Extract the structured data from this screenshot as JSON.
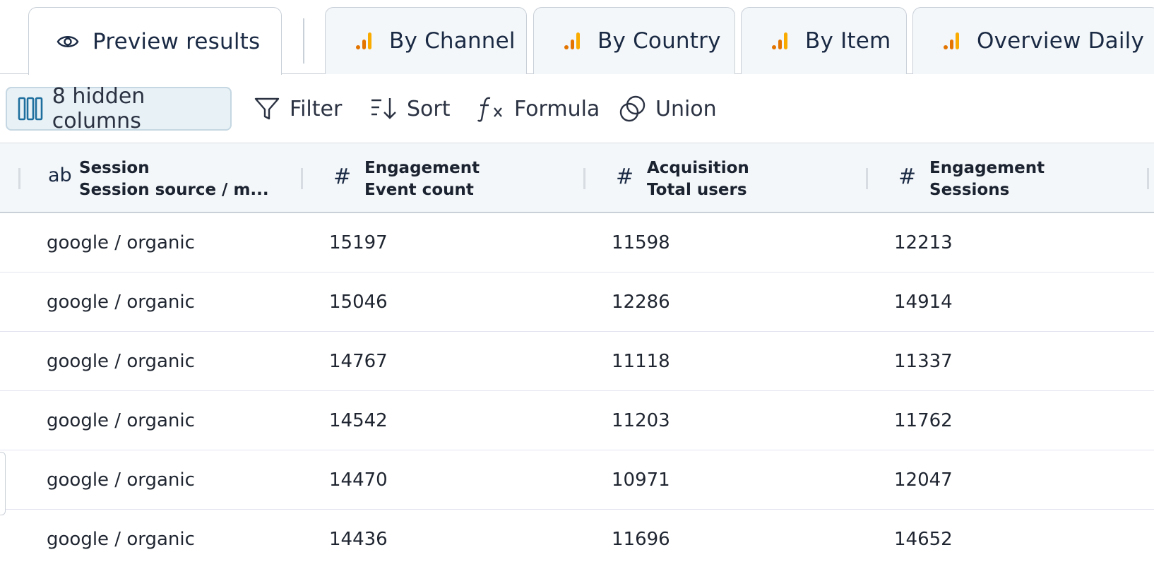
{
  "tabs": [
    {
      "label": "Preview results",
      "icon": "eye-icon",
      "active": true
    },
    {
      "label": "By Channel",
      "icon": "bar-chart-icon",
      "active": false
    },
    {
      "label": "By Country",
      "icon": "bar-chart-icon",
      "active": false
    },
    {
      "label": "By Item",
      "icon": "bar-chart-icon",
      "active": false
    },
    {
      "label": "Overview Daily",
      "icon": "bar-chart-icon",
      "active": false
    }
  ],
  "toolbar": {
    "hidden_columns_label": "8 hidden columns",
    "filter_label": "Filter",
    "sort_label": "Sort",
    "formula_label": "Formula",
    "union_label": "Union"
  },
  "columns": [
    {
      "type": "ab",
      "line1": "Session",
      "line2": "Session source / m..."
    },
    {
      "type": "#",
      "line1": "Engagement",
      "line2": "Event count"
    },
    {
      "type": "#",
      "line1": "Acquisition",
      "line2": "Total users"
    },
    {
      "type": "#",
      "line1": "Engagement",
      "line2": "Sessions"
    }
  ],
  "rows": [
    [
      "google / organic",
      "15197",
      "11598",
      "12213"
    ],
    [
      "google / organic",
      "15046",
      "12286",
      "14914"
    ],
    [
      "google / organic",
      "14767",
      "11118",
      "11337"
    ],
    [
      "google / organic",
      "14542",
      "11203",
      "11762"
    ],
    [
      "google / organic",
      "14470",
      "10971",
      "12047"
    ],
    [
      "google / organic",
      "14436",
      "11696",
      "14652"
    ]
  ],
  "colors": {
    "accent_orange": "#f29900",
    "accent_dark_orange": "#e37400",
    "icon_blue": "#1f6f9e"
  }
}
